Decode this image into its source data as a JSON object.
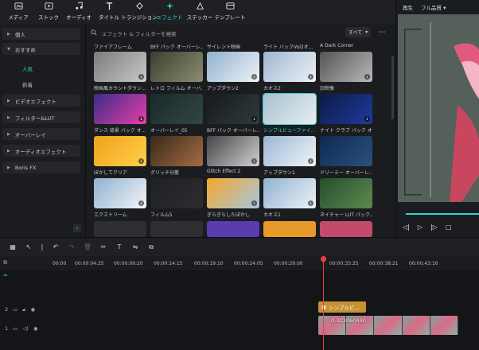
{
  "toolbar": {
    "items": [
      {
        "label": "メディア",
        "icon": "media-icon"
      },
      {
        "label": "ストック",
        "icon": "stock-icon"
      },
      {
        "label": "オーディオ",
        "icon": "music-note-icon"
      },
      {
        "label": "タイトル",
        "icon": "title-T-icon"
      },
      {
        "label": "トランジション",
        "icon": "transition-icon"
      },
      {
        "label": "エフェクト",
        "icon": "effects-sparkle-icon"
      },
      {
        "label": "ステッカー",
        "icon": "sticker-icon"
      },
      {
        "label": "テンプレート",
        "icon": "template-icon"
      }
    ],
    "active": "エフェクト"
  },
  "sidebar": {
    "categories": [
      {
        "label": "個人",
        "expanded": false
      },
      {
        "label": "おすすめ",
        "expanded": true
      },
      {
        "label": "ビデオエフェクト",
        "expanded": false
      },
      {
        "label": "フィルター&LUT",
        "expanded": false
      },
      {
        "label": "オーバーレイ",
        "expanded": false
      },
      {
        "label": "オーディオエフェクト",
        "expanded": false
      },
      {
        "label": "Boris FX",
        "expanded": false
      }
    ],
    "subitems": [
      {
        "label": "人気",
        "active": true
      },
      {
        "label": "新着",
        "active": false
      }
    ]
  },
  "search": {
    "placeholder": "エフェクト & フィルターを検索"
  },
  "filter": {
    "label": "すべて"
  },
  "effects_top_row": [
    "ファイアフレーム",
    "BFF パック オーバーレ...",
    "サイレント映画",
    "ライト バックVol2オ...",
    "A Dark Corner"
  ],
  "effects": [
    {
      "label": "映画風カウントダウン...",
      "colors": [
        "#7b7b7b",
        "#c9c9c9"
      ],
      "has_download": true
    },
    {
      "label": "レトロ フィルム オーバ...",
      "colors": [
        "#3a3f2c",
        "#8b8e74"
      ],
      "has_download": false
    },
    {
      "label": "アップダウン2",
      "colors": [
        "#8fb1d0",
        "#f0f3f7"
      ],
      "has_download": true
    },
    {
      "label": "カオス2",
      "colors": [
        "#9eb6d2",
        "#eef1f5"
      ],
      "has_download": true
    },
    {
      "label": "旧映像",
      "colors": [
        "#545454",
        "#b8b8b8"
      ],
      "has_download": true
    },
    {
      "label": "ダンス 背景 パック オ...",
      "colors": [
        "#3b2d8a",
        "#e93fa6"
      ],
      "has_download": true
    },
    {
      "label": "オーバーレイ_05",
      "colors": [
        "#1a2a28",
        "#314743"
      ],
      "has_download": false
    },
    {
      "label": "BFF パック オーバーレ...",
      "colors": [
        "#171b1d",
        "#2e3a3d"
      ],
      "has_download": true
    },
    {
      "label": "シンプルビューファイ...",
      "colors": [
        "#a7c0cf",
        "#e6eef3"
      ],
      "has_download": false,
      "selected": true
    },
    {
      "label": "ナイト クラブ パック オ...",
      "colors": [
        "#0d1a44",
        "#1e3b9e"
      ],
      "has_download": true
    },
    {
      "label": "ぼかしてクリア",
      "colors": [
        "#f0a11c",
        "#ffd04a"
      ],
      "has_download": true
    },
    {
      "label": "グリッチ分散",
      "colors": [
        "#3a2a1a",
        "#a36c45"
      ],
      "has_download": false
    },
    {
      "label": "Glitch Effect 2",
      "colors": [
        "#454545",
        "#d1d1d1"
      ],
      "has_download": true
    },
    {
      "label": "アップダウン1",
      "colors": [
        "#99b7d5",
        "#f1f4f7"
      ],
      "has_download": true
    },
    {
      "label": "ドリーミー オーバーレ...",
      "colors": [
        "#0d2b52",
        "#2c4f7d"
      ],
      "has_download": false
    },
    {
      "label": "エクストリーム",
      "colors": [
        "#8fb1d0",
        "#f3f5f8"
      ],
      "has_download": true
    },
    {
      "label": "フィルム5",
      "colors": [
        "#1e2024",
        "#2b2d31"
      ],
      "has_download": false
    },
    {
      "label": "ぎらぎらしたぼかし",
      "colors": [
        "#f5a72a",
        "#a5c8e0"
      ],
      "has_download": true
    },
    {
      "label": "カオス1",
      "colors": [
        "#90b2d2",
        "#eef2f6"
      ],
      "has_download": true
    },
    {
      "label": "ネイチャー LUT パック...",
      "colors": [
        "#264e2d",
        "#5d8a4e"
      ],
      "has_download": false
    }
  ],
  "effects_bottom_strip": [
    "#2d2f33",
    "#2d2f33",
    "#5a3bb0",
    "#e89a28",
    "#c24a6b"
  ],
  "preview": {
    "play_label": "再生",
    "quality_label": "フル品質",
    "progress": 1.0
  },
  "timeline": {
    "ticks": [
      "00:00",
      "00:00:04:25",
      "00:00:09:20",
      "00:00:14:15",
      "00:00:19:10",
      "00:00:24:05",
      "00:00:29:00",
      "00:00:33:25",
      "00:00:38:21",
      "00:00:43:16"
    ],
    "track2_label": "2",
    "track1_label": "1",
    "effect_clip_label": "シンプルビ...",
    "video_clip_label": "0.3C3060440"
  },
  "colors": {
    "accent": "#2fd6d2",
    "playhead": "#e8414b",
    "effect_clip": "#c59232",
    "video_clip": "#26605a"
  }
}
